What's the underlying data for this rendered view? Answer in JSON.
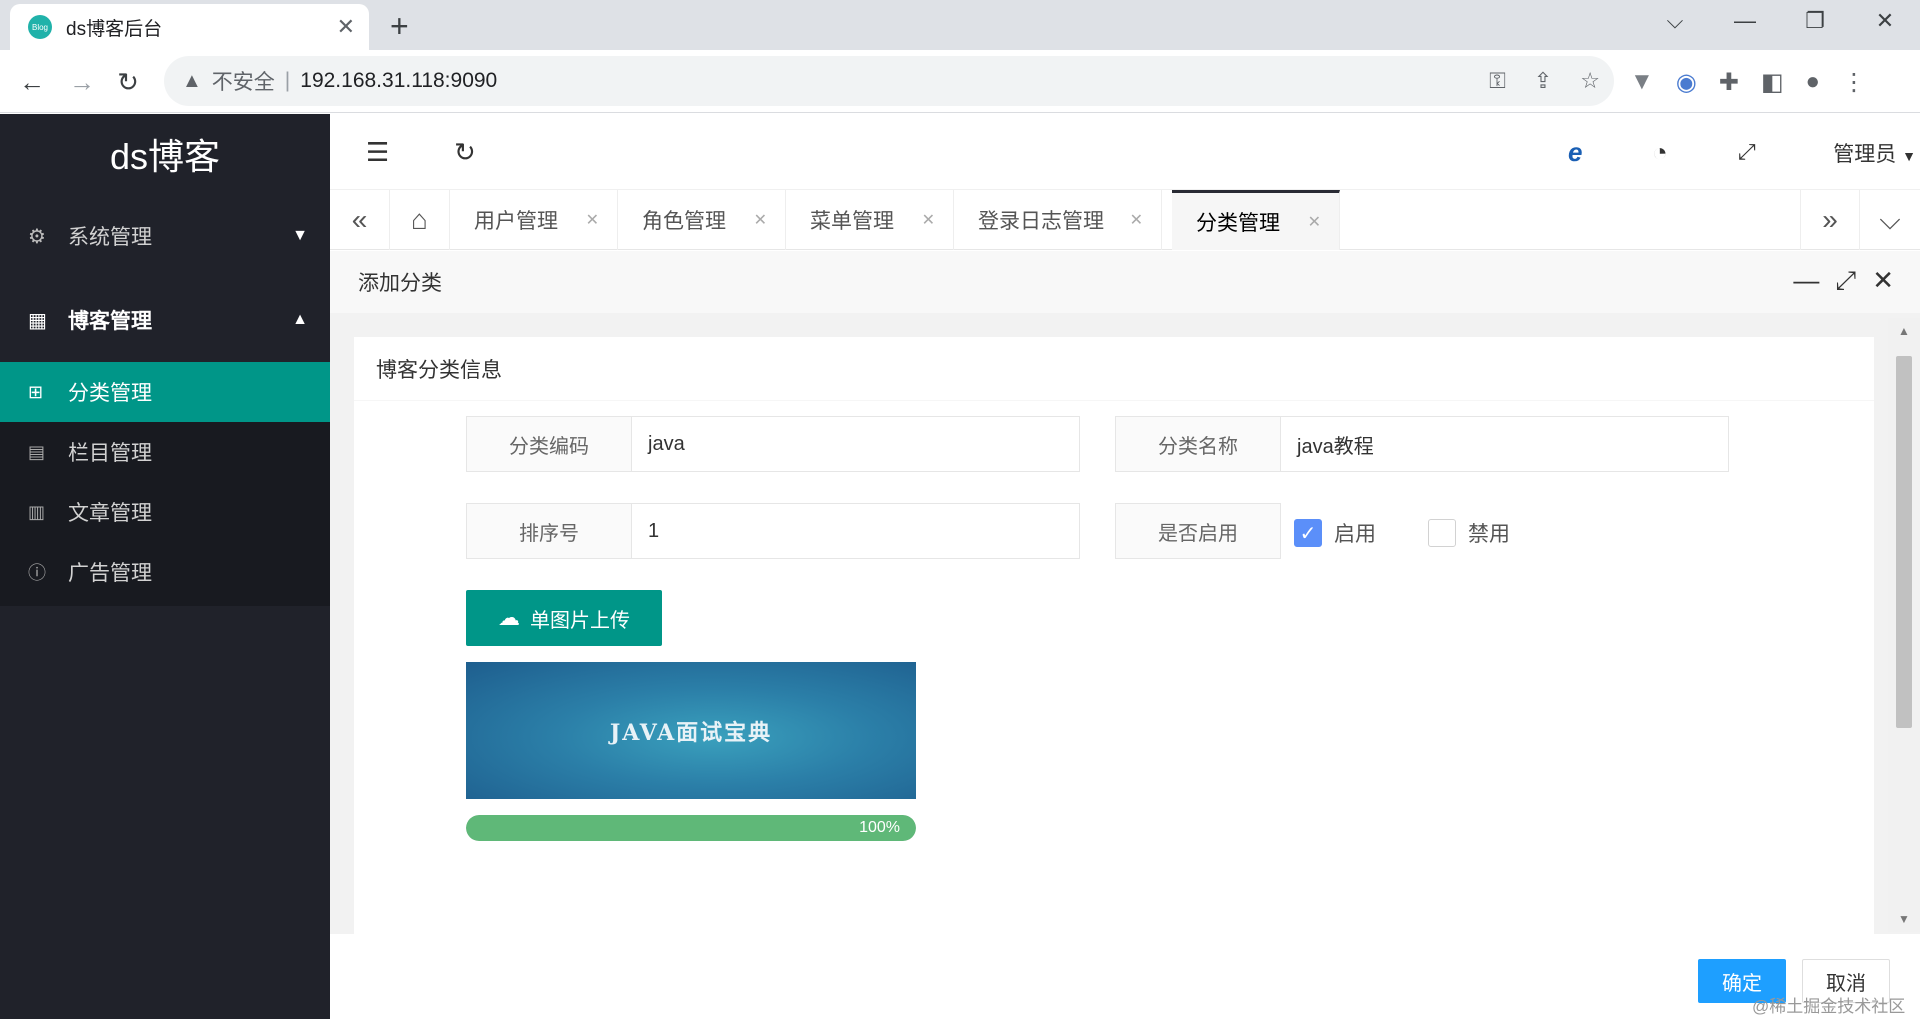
{
  "browser": {
    "tab_title": "ds博客后台",
    "favicon_text": "Blog",
    "insecure_label": "不安全",
    "url": "192.168.31.118:9090"
  },
  "sidebar": {
    "brand": "ds博客",
    "groups": [
      {
        "label": "系统管理",
        "icon": "gear-icon",
        "expanded": false
      },
      {
        "label": "博客管理",
        "icon": "calendar-icon",
        "expanded": true
      }
    ],
    "items": [
      {
        "label": "分类管理",
        "icon": "grid-icon",
        "active": true
      },
      {
        "label": "栏目管理",
        "icon": "columns-icon",
        "active": false
      },
      {
        "label": "文章管理",
        "icon": "document-icon",
        "active": false
      },
      {
        "label": "广告管理",
        "icon": "info-icon",
        "active": false
      }
    ]
  },
  "header": {
    "admin_label": "管理员"
  },
  "tabs": [
    {
      "label": "用户管理"
    },
    {
      "label": "角色管理"
    },
    {
      "label": "菜单管理"
    },
    {
      "label": "登录日志管理"
    },
    {
      "label": "分类管理",
      "active": true
    }
  ],
  "dialog": {
    "title": "添加分类",
    "card_title": "博客分类信息",
    "fields": {
      "code_label": "分类编码",
      "code_value": "java",
      "name_label": "分类名称",
      "name_value": "java教程",
      "sort_label": "排序号",
      "sort_value": "1",
      "enabled_label": "是否启用",
      "enable_option": "启用",
      "disable_option": "禁用"
    },
    "enabled": true,
    "upload_label": "单图片上传",
    "preview_text": "JAVA面试宝典",
    "progress_text": "100%",
    "progress_fraction": 1.0,
    "ok_label": "确定",
    "cancel_label": "取消"
  },
  "watermark": "@稀土掘金技术社区",
  "colors": {
    "accent": "#009688",
    "sidebar_bg": "#20222a",
    "primary_button": "#1e9fff",
    "progress": "#5fb878",
    "checkbox": "#5b8ff9"
  }
}
